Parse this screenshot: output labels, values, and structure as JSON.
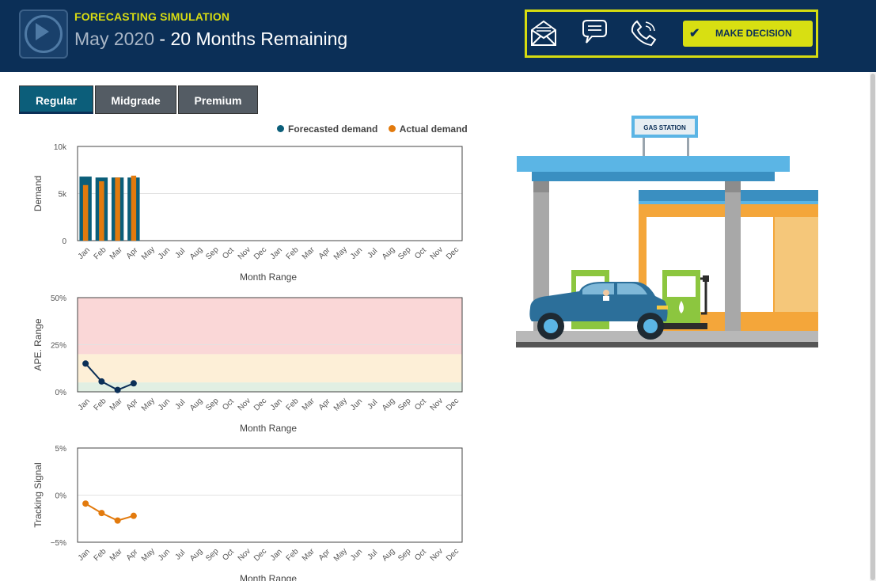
{
  "header": {
    "sim_label": "FORECASTING SIMULATION",
    "date": "May 2020",
    "separator": " - ",
    "remaining": "20 Months Remaining",
    "make_decision_label": "MAKE DECISION",
    "icons": [
      "play-icon",
      "envelope-icon",
      "chat-bubble-icon",
      "phone-icon",
      "check-icon"
    ],
    "accent_color": "#d8df12",
    "bg_color": "#0b2f57"
  },
  "tabs": [
    {
      "label": "Regular",
      "active": true
    },
    {
      "label": "Midgrade",
      "active": false
    },
    {
      "label": "Premium",
      "active": false
    }
  ],
  "legend": {
    "forecast": "Forecasted demand",
    "actual": "Actual demand",
    "forecast_color": "#0b5e79",
    "actual_color": "#e27a0d"
  },
  "gas_station_sign": "GAS STATION",
  "chart_data": [
    {
      "type": "bar",
      "categories": [
        "Jan",
        "Feb",
        "Mar",
        "Apr",
        "May",
        "Jun",
        "Jul",
        "Aug",
        "Sep",
        "Oct",
        "Nov",
        "Dec",
        "Jan",
        "Feb",
        "Mar",
        "Apr",
        "May",
        "Jun",
        "Jul",
        "Aug",
        "Sep",
        "Oct",
        "Nov",
        "Dec"
      ],
      "series": [
        {
          "name": "Forecasted demand",
          "values": [
            6800,
            6700,
            6700,
            6700
          ]
        },
        {
          "name": "Actual demand",
          "values": [
            5900,
            6300,
            6700,
            6900
          ]
        }
      ],
      "ylabel": "Demand",
      "xlabel": "Month Range",
      "ylim": [
        0,
        10000
      ],
      "yticks": [
        "0",
        "5k",
        "10k"
      ],
      "legend": "top-right"
    },
    {
      "type": "line",
      "categories": [
        "Jan",
        "Feb",
        "Mar",
        "Apr",
        "May",
        "Jun",
        "Jul",
        "Aug",
        "Sep",
        "Oct",
        "Nov",
        "Dec",
        "Jan",
        "Feb",
        "Mar",
        "Apr",
        "May",
        "Jun",
        "Jul",
        "Aug",
        "Sep",
        "Oct",
        "Nov",
        "Dec"
      ],
      "series": [
        {
          "values": [
            15,
            5.5,
            1,
            4.5
          ]
        }
      ],
      "bands": [
        {
          "from": 0,
          "to": 5,
          "color": "#e1efe3"
        },
        {
          "from": 5,
          "to": 20,
          "color": "#fdefd7"
        },
        {
          "from": 20,
          "to": 50,
          "color": "#fad7d7"
        }
      ],
      "ylabel": "APE. Range",
      "xlabel": "Month Range",
      "ylim": [
        0,
        50
      ],
      "yticks": [
        "0%",
        "25%",
        "50%"
      ]
    },
    {
      "type": "line",
      "categories": [
        "Jan",
        "Feb",
        "Mar",
        "Apr",
        "May",
        "Jun",
        "Jul",
        "Aug",
        "Sep",
        "Oct",
        "Nov",
        "Dec",
        "Jan",
        "Feb",
        "Mar",
        "Apr",
        "May",
        "Jun",
        "Jul",
        "Aug",
        "Sep",
        "Oct",
        "Nov",
        "Dec"
      ],
      "series": [
        {
          "values": [
            -0.9,
            -1.9,
            -2.7,
            -2.2
          ]
        }
      ],
      "ylabel": "Tracking Signal",
      "xlabel": "Month Range",
      "ylim": [
        -5,
        5
      ],
      "yticks": [
        "−5%",
        "0%",
        "5%"
      ]
    }
  ]
}
